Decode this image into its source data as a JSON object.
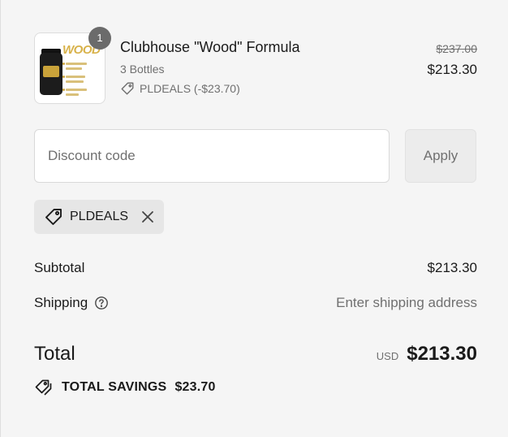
{
  "cart_item": {
    "quantity": "1",
    "name": "Clubhouse \"Wood\" Formula",
    "variant": "3 Bottles",
    "discount_applied": "PLDEALS (-$23.70)",
    "original_price": "$237.00",
    "price": "$213.30",
    "image_icon": "product-bottle-image",
    "image_brand_text": "WOOD"
  },
  "discount": {
    "placeholder": "Discount code",
    "apply_label": "Apply"
  },
  "applied_code": {
    "code": "PLDEALS",
    "tag_icon": "tag-icon",
    "remove_icon": "close-icon"
  },
  "summary": {
    "subtotal_label": "Subtotal",
    "subtotal_value": "$213.30",
    "shipping_label": "Shipping",
    "shipping_help_icon": "question-circle-icon",
    "shipping_value": "Enter shipping address",
    "total_label": "Total",
    "currency": "USD",
    "total_value": "$213.30",
    "savings_label": "TOTAL SAVINGS",
    "savings_value": "$23.70"
  },
  "colors": {
    "background": "#f5f5f5",
    "text": "#1a1a1a",
    "muted": "#707070",
    "badge": "#6b6b6b",
    "brand_gold": "#d8b24a"
  }
}
